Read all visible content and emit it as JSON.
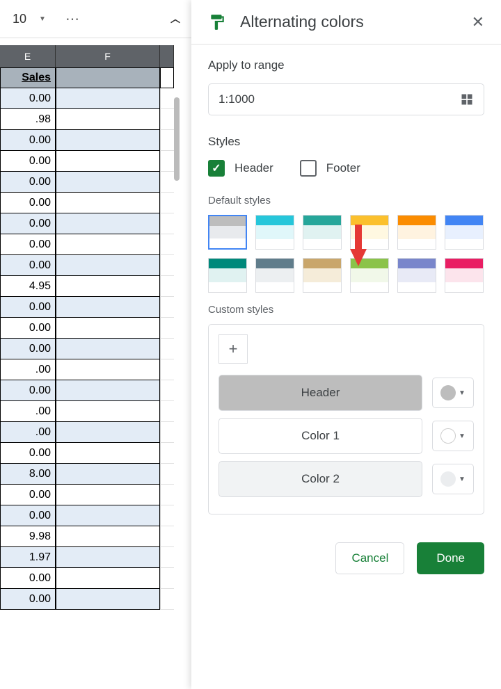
{
  "toolbar": {
    "font_size": "10"
  },
  "columns": {
    "e": "E",
    "f": "F"
  },
  "header_cell": "Sales",
  "cells": [
    "0.00",
    ".98",
    "0.00",
    "0.00",
    "0.00",
    "0.00",
    "0.00",
    "0.00",
    "0.00",
    "4.95",
    "0.00",
    "0.00",
    "0.00",
    ".00",
    "0.00",
    ".00",
    ".00",
    "0.00",
    "8.00",
    "0.00",
    "0.00",
    "9.98",
    "1.97",
    "0.00",
    "0.00"
  ],
  "panel": {
    "title": "Alternating colors",
    "apply_label": "Apply to range",
    "range": "1:1000",
    "styles_label": "Styles",
    "header_checkbox": "Header",
    "footer_checkbox": "Footer",
    "default_label": "Default styles",
    "custom_label": "Custom styles",
    "rows": {
      "header": "Header",
      "c1": "Color 1",
      "c2": "Color 2"
    },
    "cancel": "Cancel",
    "done": "Done"
  },
  "swatches": [
    {
      "top": "#bdbdbd",
      "mid": "#e8eaed",
      "bot": "#ffffff",
      "selected": true
    },
    {
      "top": "#26c6da",
      "mid": "#e0f7fa",
      "bot": "#ffffff"
    },
    {
      "top": "#26a69a",
      "mid": "#e0f2f1",
      "bot": "#ffffff"
    },
    {
      "top": "#fbc02d",
      "mid": "#fff8e1",
      "bot": "#ffffff"
    },
    {
      "top": "#fb8c00",
      "mid": "#fff3e0",
      "bot": "#ffffff"
    },
    {
      "top": "#4285f4",
      "mid": "#e8f0fe",
      "bot": "#ffffff"
    },
    {
      "top": "#00897b",
      "mid": "#e0f2f1",
      "bot": "#ffffff"
    },
    {
      "top": "#607d8b",
      "mid": "#eceff1",
      "bot": "#ffffff"
    },
    {
      "top": "#c9a66b",
      "mid": "#f5ecd9",
      "bot": "#ffffff"
    },
    {
      "top": "#8bc34a",
      "mid": "#f1f8e9",
      "bot": "#ffffff"
    },
    {
      "top": "#7986cb",
      "mid": "#e8eaf6",
      "bot": "#ffffff"
    },
    {
      "top": "#e91e63",
      "mid": "#fce4ec",
      "bot": "#ffffff"
    }
  ]
}
